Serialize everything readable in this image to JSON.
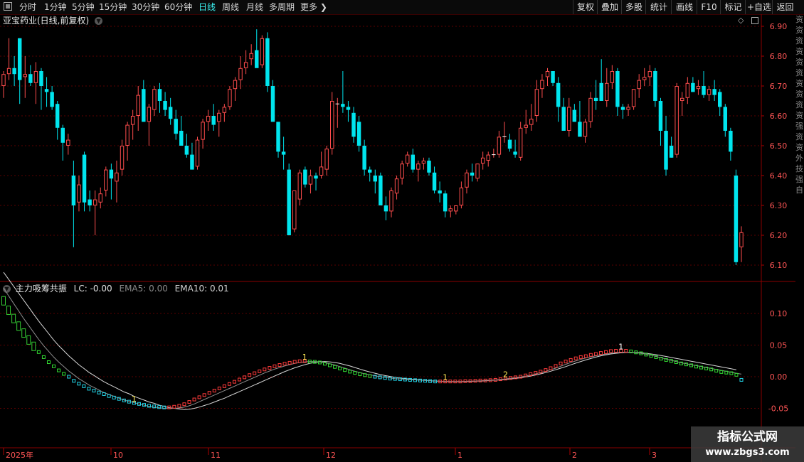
{
  "toolbar": {
    "periods": [
      {
        "label": "分时",
        "active": false
      },
      {
        "label": "1分钟",
        "active": false
      },
      {
        "label": "5分钟",
        "active": false
      },
      {
        "label": "15分钟",
        "active": false
      },
      {
        "label": "30分钟",
        "active": false
      },
      {
        "label": "60分钟",
        "active": false
      },
      {
        "label": "日线",
        "active": true
      },
      {
        "label": "周线",
        "active": false
      },
      {
        "label": "月线",
        "active": false
      },
      {
        "label": "多周期",
        "active": false
      },
      {
        "label": "更多",
        "active": false
      }
    ],
    "tools": [
      "复权",
      "叠加",
      "多股",
      "统计",
      "画线",
      "F10",
      "标记",
      "+自选",
      "返回"
    ]
  },
  "main_panel": {
    "title": "亚宝药业(日线,前复权)",
    "price_ticks": [
      "6.90",
      "6.80",
      "6.70",
      "6.60",
      "6.50",
      "6.40",
      "6.30",
      "6.20",
      "6.10"
    ]
  },
  "indicator_panel": {
    "name": "主力吸筹共振",
    "lc": "LC: -0.00",
    "ema5": "EMA5: 0.00",
    "ema10": "EMA10: 0.01",
    "ticks": [
      "0.10",
      "0.05",
      "0.00",
      "-0.05"
    ],
    "signals": [
      "1",
      "1",
      "1",
      "2",
      "1"
    ]
  },
  "date_axis": [
    "2025年",
    "10",
    "11",
    "12",
    "1",
    "2",
    "3"
  ],
  "right_strip": "资资资资资资资资资资强资资外技强自",
  "watermark": {
    "title": "指标公式网",
    "url": "www.zbgs3.com"
  },
  "colors": {
    "up": "#ff4d4d",
    "down": "#00e5ee",
    "accent": "#3cf2f2",
    "grid": "#5a0000"
  },
  "chart_data": {
    "type": "candlestick",
    "title": "亚宝药业(日线,前复权)",
    "ylim": [
      6.06,
      6.94
    ],
    "ohlc": [
      [
        6.7,
        6.75,
        6.66,
        6.74
      ],
      [
        6.74,
        6.86,
        6.72,
        6.76
      ],
      [
        6.76,
        6.8,
        6.7,
        6.74
      ],
      [
        6.86,
        6.86,
        6.64,
        6.72
      ],
      [
        6.73,
        6.8,
        6.66,
        6.74
      ],
      [
        6.74,
        6.77,
        6.7,
        6.71
      ],
      [
        6.71,
        6.78,
        6.64,
        6.75
      ],
      [
        6.75,
        6.76,
        6.62,
        6.7
      ],
      [
        6.69,
        6.73,
        6.63,
        6.68
      ],
      [
        6.68,
        6.7,
        6.62,
        6.63
      ],
      [
        6.64,
        6.65,
        6.52,
        6.56
      ],
      [
        6.56,
        6.57,
        6.45,
        6.51
      ],
      [
        6.5,
        6.54,
        6.47,
        6.52
      ],
      [
        6.4,
        6.45,
        6.16,
        6.3
      ],
      [
        6.31,
        6.4,
        6.28,
        6.37
      ],
      [
        6.47,
        6.48,
        6.28,
        6.31
      ],
      [
        6.32,
        6.35,
        6.28,
        6.3
      ],
      [
        6.3,
        6.35,
        6.2,
        6.32
      ],
      [
        6.31,
        6.36,
        6.29,
        6.34
      ],
      [
        6.35,
        6.43,
        6.33,
        6.42
      ],
      [
        6.42,
        6.44,
        6.32,
        6.39
      ],
      [
        6.38,
        6.45,
        6.31,
        6.41
      ],
      [
        6.42,
        6.52,
        6.4,
        6.5
      ],
      [
        6.5,
        6.58,
        6.45,
        6.57
      ],
      [
        6.57,
        6.62,
        6.52,
        6.6
      ],
      [
        6.6,
        6.7,
        6.55,
        6.67
      ],
      [
        6.69,
        6.72,
        6.58,
        6.58
      ],
      [
        6.58,
        6.64,
        6.5,
        6.63
      ],
      [
        6.62,
        6.7,
        6.6,
        6.69
      ],
      [
        6.69,
        6.71,
        6.61,
        6.65
      ],
      [
        6.65,
        6.68,
        6.6,
        6.62
      ],
      [
        6.63,
        6.66,
        6.57,
        6.59
      ],
      [
        6.59,
        6.62,
        6.52,
        6.54
      ],
      [
        6.55,
        6.6,
        6.5,
        6.5
      ],
      [
        6.5,
        6.54,
        6.46,
        6.47
      ],
      [
        6.47,
        6.51,
        6.42,
        6.42
      ],
      [
        6.43,
        6.53,
        6.42,
        6.52
      ],
      [
        6.52,
        6.59,
        6.49,
        6.58
      ],
      [
        6.58,
        6.62,
        6.55,
        6.6
      ],
      [
        6.6,
        6.64,
        6.55,
        6.57
      ],
      [
        6.58,
        6.62,
        6.53,
        6.61
      ],
      [
        6.61,
        6.64,
        6.58,
        6.63
      ],
      [
        6.63,
        6.7,
        6.62,
        6.69
      ],
      [
        6.69,
        6.73,
        6.65,
        6.72
      ],
      [
        6.72,
        6.8,
        6.69,
        6.76
      ],
      [
        6.76,
        6.82,
        6.74,
        6.78
      ],
      [
        6.79,
        6.84,
        6.77,
        6.81
      ],
      [
        6.82,
        6.89,
        6.79,
        6.76
      ],
      [
        6.77,
        6.87,
        6.76,
        6.86
      ],
      [
        6.86,
        6.88,
        6.68,
        6.7
      ],
      [
        6.7,
        6.72,
        6.58,
        6.58
      ],
      [
        6.58,
        6.58,
        6.46,
        6.48
      ],
      [
        6.48,
        6.53,
        6.42,
        6.47
      ],
      [
        6.42,
        6.44,
        6.2,
        6.2
      ],
      [
        6.22,
        6.35,
        6.21,
        6.35
      ],
      [
        6.32,
        6.42,
        6.3,
        6.41
      ],
      [
        6.42,
        6.43,
        6.36,
        6.37
      ],
      [
        6.37,
        6.42,
        6.34,
        6.4
      ],
      [
        6.4,
        6.41,
        6.35,
        6.39
      ],
      [
        6.4,
        6.48,
        6.39,
        6.43
      ],
      [
        6.42,
        6.5,
        6.4,
        6.49
      ],
      [
        6.49,
        6.68,
        6.47,
        6.65
      ],
      [
        6.64,
        6.66,
        6.56,
        6.64
      ],
      [
        6.64,
        6.75,
        6.61,
        6.63
      ],
      [
        6.63,
        6.65,
        6.58,
        6.62
      ],
      [
        6.61,
        6.63,
        6.51,
        6.53
      ],
      [
        6.58,
        6.6,
        6.48,
        6.5
      ],
      [
        6.5,
        6.52,
        6.4,
        6.42
      ],
      [
        6.42,
        6.43,
        6.38,
        6.41
      ],
      [
        6.4,
        6.42,
        6.34,
        6.38
      ],
      [
        6.4,
        6.41,
        6.3,
        6.3
      ],
      [
        6.3,
        6.33,
        6.25,
        6.28
      ],
      [
        6.28,
        6.36,
        6.26,
        6.35
      ],
      [
        6.34,
        6.4,
        6.32,
        6.39
      ],
      [
        6.39,
        6.45,
        6.37,
        6.44
      ],
      [
        6.44,
        6.48,
        6.43,
        6.47
      ],
      [
        6.47,
        6.49,
        6.41,
        6.42
      ],
      [
        6.42,
        6.45,
        6.38,
        6.44
      ],
      [
        6.44,
        6.46,
        6.42,
        6.45
      ],
      [
        6.45,
        6.46,
        6.4,
        6.41
      ],
      [
        6.41,
        6.43,
        6.34,
        6.35
      ],
      [
        6.35,
        6.38,
        6.31,
        6.34
      ],
      [
        6.34,
        6.35,
        6.26,
        6.28
      ],
      [
        6.28,
        6.3,
        6.26,
        6.29
      ],
      [
        6.28,
        6.3,
        6.27,
        6.3
      ],
      [
        6.3,
        6.38,
        6.29,
        6.36
      ],
      [
        6.36,
        6.42,
        6.34,
        6.41
      ],
      [
        6.41,
        6.44,
        6.38,
        6.4
      ],
      [
        6.39,
        6.44,
        6.38,
        6.44
      ],
      [
        6.44,
        6.48,
        6.42,
        6.46
      ],
      [
        6.45,
        6.48,
        6.43,
        6.47
      ],
      [
        6.47,
        6.49,
        6.46,
        6.47
      ],
      [
        6.47,
        6.55,
        6.46,
        6.53
      ],
      [
        6.53,
        6.58,
        6.51,
        6.53
      ],
      [
        6.52,
        6.54,
        6.48,
        6.49
      ],
      [
        6.48,
        6.52,
        6.46,
        6.47
      ],
      [
        6.46,
        6.58,
        6.45,
        6.56
      ],
      [
        6.56,
        6.62,
        6.54,
        6.57
      ],
      [
        6.57,
        6.64,
        6.55,
        6.59
      ],
      [
        6.6,
        6.72,
        6.58,
        6.69
      ],
      [
        6.69,
        6.74,
        6.66,
        6.72
      ],
      [
        6.73,
        6.76,
        6.7,
        6.75
      ],
      [
        6.75,
        6.75,
        6.7,
        6.71
      ],
      [
        6.71,
        6.73,
        6.58,
        6.63
      ],
      [
        6.63,
        6.66,
        6.56,
        6.55
      ],
      [
        6.55,
        6.66,
        6.53,
        6.63
      ],
      [
        6.62,
        6.64,
        6.58,
        6.58
      ],
      [
        6.58,
        6.65,
        6.54,
        6.53
      ],
      [
        6.53,
        6.59,
        6.51,
        6.58
      ],
      [
        6.58,
        6.68,
        6.56,
        6.66
      ],
      [
        6.66,
        6.72,
        6.62,
        6.65
      ],
      [
        6.71,
        6.79,
        6.7,
        6.65
      ],
      [
        6.65,
        6.76,
        6.63,
        6.71
      ],
      [
        6.71,
        6.77,
        6.69,
        6.75
      ],
      [
        6.75,
        6.76,
        6.6,
        6.63
      ],
      [
        6.63,
        6.64,
        6.59,
        6.62
      ],
      [
        6.62,
        6.64,
        6.6,
        6.63
      ],
      [
        6.63,
        6.69,
        6.62,
        6.69
      ],
      [
        6.69,
        6.74,
        6.66,
        6.72
      ],
      [
        6.72,
        6.76,
        6.7,
        6.73
      ],
      [
        6.73,
        6.77,
        6.7,
        6.75
      ],
      [
        6.75,
        6.76,
        6.63,
        6.65
      ],
      [
        6.65,
        6.66,
        6.5,
        6.55
      ],
      [
        6.55,
        6.6,
        6.4,
        6.42
      ],
      [
        6.5,
        6.53,
        6.46,
        6.46
      ],
      [
        6.47,
        6.71,
        6.46,
        6.7
      ],
      [
        6.65,
        6.68,
        6.6,
        6.66
      ],
      [
        6.66,
        6.73,
        6.64,
        6.71
      ],
      [
        6.71,
        6.73,
        6.68,
        6.68
      ],
      [
        6.69,
        6.72,
        6.67,
        6.7
      ],
      [
        6.7,
        6.75,
        6.66,
        6.67
      ],
      [
        6.67,
        6.7,
        6.65,
        6.69
      ],
      [
        6.69,
        6.72,
        6.65,
        6.67
      ],
      [
        6.68,
        6.69,
        6.6,
        6.63
      ],
      [
        6.63,
        6.64,
        6.53,
        6.55
      ],
      [
        6.55,
        6.56,
        6.45,
        6.48
      ],
      [
        6.4,
        6.42,
        6.1,
        6.11
      ],
      [
        6.16,
        6.23,
        6.11,
        6.21
      ]
    ],
    "indicator": {
      "ylim": [
        -0.11,
        0.19
      ],
      "osc": [
        0.12,
        0.105,
        0.092,
        0.08,
        0.069,
        0.058,
        0.048,
        0.039,
        0.031,
        0.023,
        0.0165,
        0.01,
        0.0045,
        0.0,
        -0.0065,
        -0.011,
        -0.015,
        -0.019,
        -0.022,
        -0.025,
        -0.0275,
        -0.0305,
        -0.033,
        -0.035,
        -0.0375,
        -0.0395,
        -0.0415,
        -0.043,
        -0.0445,
        -0.046,
        -0.047,
        -0.048,
        -0.0485,
        -0.0485,
        -0.0475,
        -0.046,
        -0.0435,
        -0.04,
        -0.036,
        -0.0325,
        -0.029,
        -0.0255,
        -0.022,
        -0.0185,
        -0.015,
        -0.0115,
        -0.008,
        -0.0045,
        -0.001,
        0.0025,
        0.0055,
        0.0085,
        0.0115,
        0.014,
        0.0165,
        0.0185,
        0.0205,
        0.022,
        0.0235,
        0.0245,
        0.0245,
        0.024,
        0.0235,
        0.0225,
        0.0205,
        0.018,
        0.0155,
        0.013,
        0.0105,
        0.008,
        0.006,
        0.004,
        0.0025,
        0.001,
        0.0,
        -0.001,
        -0.002,
        -0.003,
        -0.0035,
        -0.004,
        -0.0045,
        -0.005,
        -0.0055,
        -0.006,
        -0.0065,
        -0.007,
        -0.0075,
        -0.0075,
        -0.0075,
        -0.0075,
        -0.0075,
        -0.0075,
        -0.007,
        -0.007,
        -0.0065,
        -0.006,
        -0.006,
        -0.0055,
        -0.005,
        -0.004,
        -0.003,
        -0.002,
        -0.001,
        0.0,
        0.002,
        0.004,
        0.006,
        0.008,
        0.0105,
        0.0135,
        0.017,
        0.021,
        0.024,
        0.0265,
        0.029,
        0.031,
        0.0325,
        0.0345,
        0.036,
        0.0375,
        0.039,
        0.0405,
        0.041,
        0.041,
        0.041,
        0.04,
        0.0385,
        0.037,
        0.035,
        0.033,
        0.031,
        0.0285,
        0.0265,
        0.025,
        0.023,
        0.021,
        0.0195,
        0.018,
        0.016,
        0.0145,
        0.013,
        0.0115,
        0.0095,
        0.0075,
        0.0065,
        0.0055,
        0.003,
        -0.005
      ],
      "ema5": [
        0.14,
        0.128,
        0.116,
        0.104,
        0.092,
        0.081,
        0.07,
        0.059,
        0.049,
        0.04,
        0.031,
        0.023,
        0.016,
        0.009,
        0.003,
        -0.003,
        -0.008,
        -0.013,
        -0.017,
        -0.021,
        -0.025,
        -0.028,
        -0.031,
        -0.034,
        -0.037,
        -0.039,
        -0.041,
        -0.043,
        -0.045,
        -0.047,
        -0.048,
        -0.049,
        -0.05,
        -0.0505,
        -0.05,
        -0.0495,
        -0.048,
        -0.046,
        -0.043,
        -0.0395,
        -0.036,
        -0.0325,
        -0.029,
        -0.0255,
        -0.022,
        -0.0185,
        -0.015,
        -0.0115,
        -0.008,
        -0.0045,
        -0.001,
        0.0025,
        0.006,
        0.009,
        0.012,
        0.0145,
        0.017,
        0.019,
        0.021,
        0.0225,
        0.0235,
        0.024,
        0.024,
        0.0235,
        0.022,
        0.0205,
        0.0185,
        0.016,
        0.0135,
        0.011,
        0.0085,
        0.0065,
        0.0045,
        0.003,
        0.0015,
        0.0,
        -0.001,
        -0.002,
        -0.003,
        -0.0035,
        -0.004,
        -0.0045,
        -0.005,
        -0.0055,
        -0.006,
        -0.0065,
        -0.007,
        -0.0073,
        -0.0075,
        -0.0075,
        -0.0075,
        -0.0075,
        -0.0073,
        -0.007,
        -0.0068,
        -0.0064,
        -0.006,
        -0.0056,
        -0.0052,
        -0.0045,
        -0.0035,
        -0.0025,
        -0.0015,
        -0.0005,
        0.001,
        0.0025,
        0.0045,
        0.0065,
        0.0085,
        0.011,
        0.0135,
        0.0165,
        0.0195,
        0.0225,
        0.025,
        0.0275,
        0.0295,
        0.0315,
        0.033,
        0.0345,
        0.036,
        0.037,
        0.038,
        0.0385,
        0.039,
        0.0385,
        0.038,
        0.037,
        0.0355,
        0.034,
        0.032,
        0.03,
        0.028,
        0.026,
        0.024,
        0.022,
        0.0205,
        0.019,
        0.0175,
        0.016,
        0.0145,
        0.013,
        0.0115,
        0.01,
        0.0085,
        0.007,
        0.0055,
        0.004
      ],
      "ema10": [
        0.165,
        0.154,
        0.143,
        0.132,
        0.121,
        0.11,
        0.099,
        0.088,
        0.078,
        0.068,
        0.058,
        0.049,
        0.041,
        0.033,
        0.026,
        0.019,
        0.013,
        0.007,
        0.002,
        -0.003,
        -0.008,
        -0.012,
        -0.016,
        -0.02,
        -0.024,
        -0.027,
        -0.031,
        -0.034,
        -0.037,
        -0.04,
        -0.042,
        -0.045,
        -0.047,
        -0.049,
        -0.05,
        -0.051,
        -0.052,
        -0.0515,
        -0.05,
        -0.048,
        -0.0455,
        -0.043,
        -0.04,
        -0.037,
        -0.034,
        -0.0305,
        -0.027,
        -0.0235,
        -0.02,
        -0.0165,
        -0.013,
        -0.0095,
        -0.006,
        -0.0025,
        0.001,
        0.0045,
        0.008,
        0.011,
        0.014,
        0.0165,
        0.019,
        0.021,
        0.0225,
        0.0235,
        0.024,
        0.0235,
        0.0225,
        0.021,
        0.019,
        0.017,
        0.0145,
        0.012,
        0.0095,
        0.0075,
        0.0055,
        0.0035,
        0.0018,
        0.0005,
        -0.001,
        -0.002,
        -0.003,
        -0.0038,
        -0.0045,
        -0.0052,
        -0.0058,
        -0.0063,
        -0.0068,
        -0.0072,
        -0.0075,
        -0.0076,
        -0.0077,
        -0.0077,
        -0.0076,
        -0.0074,
        -0.0071,
        -0.0068,
        -0.0064,
        -0.006,
        -0.0055,
        -0.005,
        -0.0044,
        -0.0036,
        -0.0027,
        -0.0017,
        -0.0005,
        0.001,
        0.0027,
        0.0045,
        0.0065,
        0.0087,
        0.011,
        0.0135,
        0.016,
        0.0188,
        0.0215,
        0.024,
        0.0265,
        0.0288,
        0.031,
        0.033,
        0.0345,
        0.036,
        0.037,
        0.0378,
        0.0383,
        0.0385,
        0.0383,
        0.0378,
        0.037,
        0.036,
        0.0348,
        0.0335,
        0.032,
        0.0305,
        0.029,
        0.0275,
        0.026,
        0.0245,
        0.023,
        0.0215,
        0.02,
        0.0185,
        0.017,
        0.0155,
        0.014,
        0.0125,
        0.011
      ]
    }
  }
}
